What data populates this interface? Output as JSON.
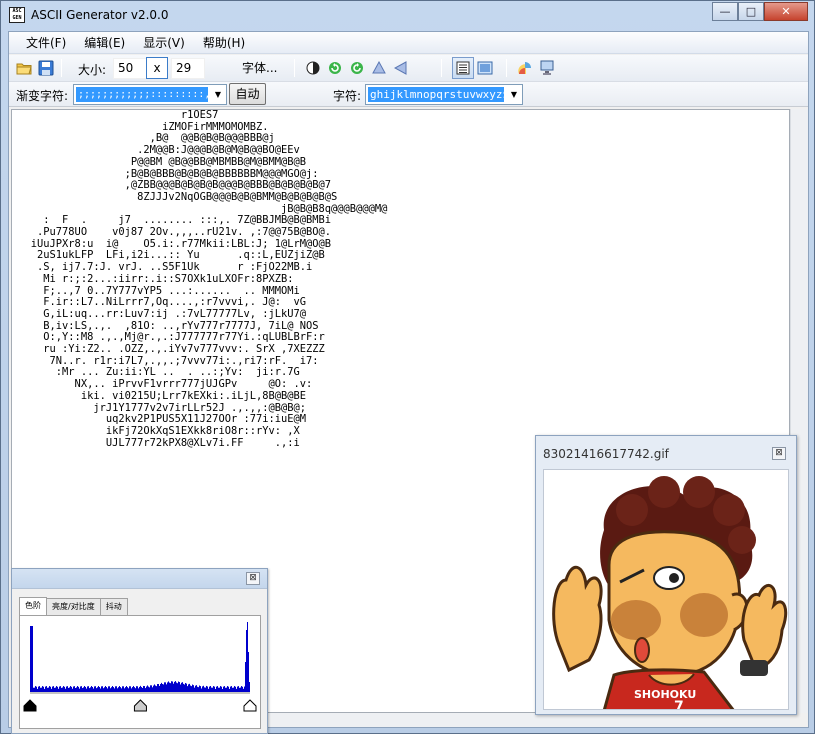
{
  "window": {
    "title": "ASCII Generator v2.0.0",
    "icon_text_top": "ASC",
    "icon_text_bottom": "GEN",
    "min_glyph": "—",
    "max_glyph": "□",
    "close_glyph": "✕"
  },
  "menu": {
    "items": [
      "文件(F)",
      "编辑(E)",
      "显示(V)",
      "帮助(H)"
    ]
  },
  "toolbar": {
    "size_label": "大小:",
    "width_value": "50",
    "x_label": "x",
    "height_value": "29",
    "font_button": "字体...",
    "gradient_label": "渐变字符:",
    "gradient_value": ";;;;;;;;;;;;:::::::::,:,,,.,.,.,,,,,,,.........",
    "auto_button": "自动",
    "chars_label": "字符:",
    "chars_value": "ghijklmnopqrstuvwxyz$"
  },
  "ascii_art": "                           r1OES7\n                        iZMOFirMMMOMOMBZ.\n                      ,B@  @@B@B@B@@@BBB@j\n                    .2M@@B:J@@@B@B@M@B@@BO@EEv\n                   P@@BM @B@@BB@MBMBB@M@BMM@B@B\n                  ;B@B@BBB@B@B@B@BBBBBBM@@@MGO@j:\n                  ,@ZBB@@@B@B@B@B@@@B@BBB@B@B@B@B@7\n                    8ZJJJv2NqOGB@@@B@B@BMM@B@B@B@B@S\n                                           jB@B@B8q@@@B@@@M@\n     :  F  .     j7  ........ :::,. 7Z@BBJMB@B@BMBi\n    .Pu778UO    v0j87 2Ov.,,,..rU21v. ,:7@@75B@BO@.\n   iUuJPXr8:u  i@    O5.i:.r77Mkii:LBL:J; 1@LrM@O@B\n    2uS1ukLFP  LFi,i2i...:: Yu      .q::L,EUZjiZ@B\n    .S, ij7.7:J. vrJ. ..S5F1Uk      r :FjO22MB.i\n     Mi r:;:2...:iirr:.i::S7OXk1uLXOFr:8PXZB:\n     F;..,7 0..7Y777vYP5 ...:......  .. MMMOMi\n     F.ir::L7..NiLrrr7,Oq....,:r7vvvi,. J@:  vG\n     G,iL:uq...rr:Luv7:ij .:7vL77777Lv, :jLkU7@\n     B,iv:LS,.,.  ,81O: ..,rYv777r7777J, 7iL@ NOS\n     O:,Y::M8 .,.,Mj@r.,.:J777777r77Yi.:qLUBLBrF:r\n     ru :Yi:Z2.. .OZZ,.,.iYv7v777vvv:. SrX ,7XEZZZ\n      7N..r. r1r:i7L7,.,,.;7vvv77i:.,ri7:rF.  i7:\n       :Mr ... Zu:ii:YL ..  . ..:;Yv:  ji:r.7G\n          NX,.. iPrvvF1vrrr777jUJGPv     @O: .v:\n           iki. vi0215U;Lrr7kEXki:.iLjL,8B@B@BE\n             jrJ1Y1777v2v7irLLr52J .,.,,:@B@B@;\n               uq2kv2P1PUS5X11J27OOr :77i:iuE@M\n               ikFj72OkXqS1EXkk8riO8r::rYv: ,X\n               UJL777r72kPX8@XLv7i.FF     .,:i",
  "histogram": {
    "close_glyph": "⊠",
    "tabs": [
      "色阶",
      "亮度/对比度",
      "抖动"
    ],
    "active_tab": 0,
    "slider_black": 0,
    "slider_mid": 128,
    "slider_white": 255
  },
  "preview": {
    "filename": "83021416617742.gif",
    "close_glyph": "⊠",
    "shirt_text": "SHOHOKU",
    "shirt_number": "7"
  },
  "colors": {
    "selection": "#3399ff",
    "histogram_bars": "#0000cc",
    "skin": "#f5b95f",
    "cheek": "#c9823a",
    "hair": "#5a1a12",
    "jersey": "#c8281e"
  }
}
